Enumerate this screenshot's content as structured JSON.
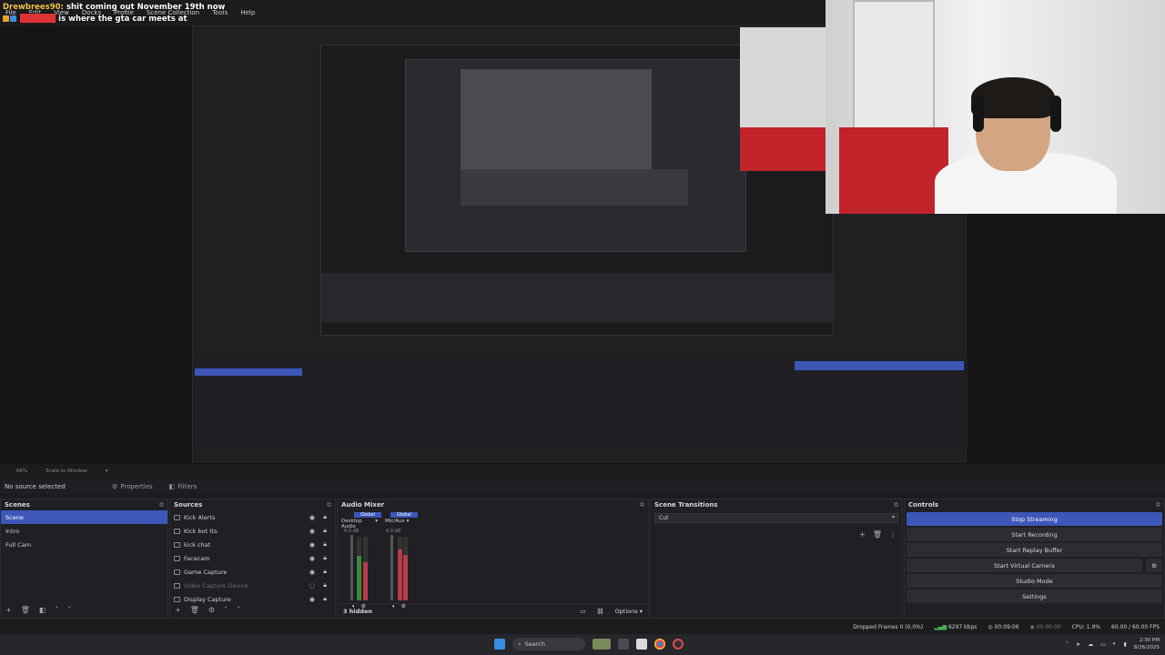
{
  "chat": {
    "line1_user": "Drewbrees90:",
    "line1_msg": "shit coming out November 19th now",
    "line2_user": "",
    "line2_msg": "is where the gta car meets at"
  },
  "menu": [
    "File",
    "Edit",
    "View",
    "Docks",
    "Profile",
    "Scene Collection",
    "Tools",
    "Help"
  ],
  "zoombar": {
    "zoom": "66%",
    "scale": "Scale to Window"
  },
  "props": {
    "no_source": "No source selected",
    "properties": "Properties",
    "filters": "Filters"
  },
  "scenes": {
    "title": "Scenes",
    "items": [
      "Scene",
      "Intro",
      "Full Cam"
    ]
  },
  "sources": {
    "title": "Sources",
    "items": [
      "Kick Alerts",
      "Kick bot tts",
      "kick chat",
      "Facecam",
      "Game Capture",
      "Video Capture Device",
      "Display Capture"
    ]
  },
  "mixer": {
    "title": "Audio Mixer",
    "ch1_global": "Global",
    "ch1_name": "Desktop Audio",
    "ch1_db": "0.0 dB",
    "ch2_global": "Global",
    "ch2_name": "Mic/Aux",
    "ch2_db": "0.0 dB",
    "hidden": "3 hidden",
    "options": "Options",
    "levels": {
      "ch1": 0.7,
      "ch2": 0.8
    }
  },
  "transitions": {
    "title": "Scene Transitions",
    "selected": "Cut"
  },
  "controls": {
    "title": "Controls",
    "buttons": [
      "Stop Streaming",
      "Start Recording",
      "Start Replay Buffer",
      "Start Virtual Camera",
      "Studio Mode",
      "Settings"
    ]
  },
  "status": {
    "dropped": "Dropped Frames 0 (0.0%)",
    "bitrate": "6297 kbps",
    "stream_time": "00:09:06",
    "rec_time": "00:00:00",
    "cpu": "CPU: 1.9%",
    "fps": "60.00 / 60.00 FPS"
  },
  "taskbar": {
    "search": "Search",
    "time": "2:30 PM",
    "date": "8/26/2025"
  },
  "colors": {
    "accent": "#3c57b8",
    "chat_user": "#f4c94f"
  }
}
